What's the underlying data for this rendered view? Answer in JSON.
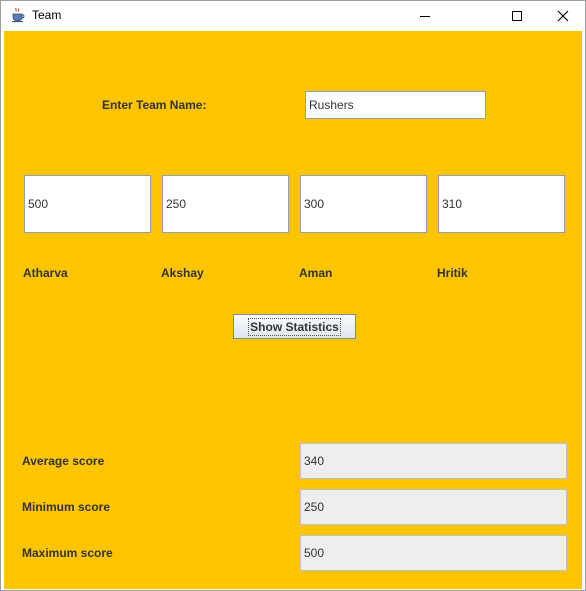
{
  "window": {
    "title": "Team",
    "icons": {
      "app": "java-cup-icon",
      "minimize": "minimize-icon",
      "maximize": "maximize-icon",
      "close": "close-icon"
    }
  },
  "colors": {
    "background": "#fdc500"
  },
  "team": {
    "name_label": "Enter Team Name:",
    "name_value": "Rushers"
  },
  "players": [
    {
      "score": "500",
      "name": "Atharva"
    },
    {
      "score": "250",
      "name": "Akshay"
    },
    {
      "score": "300",
      "name": "Aman"
    },
    {
      "score": "310",
      "name": "Hritik"
    }
  ],
  "actions": {
    "show_stats_label": "Show Statistics"
  },
  "stats": {
    "average_label": "Average score",
    "average_value": "340",
    "minimum_label": "Minimum score",
    "minimum_value": "250",
    "maximum_label": "Maximum score",
    "maximum_value": "500"
  }
}
